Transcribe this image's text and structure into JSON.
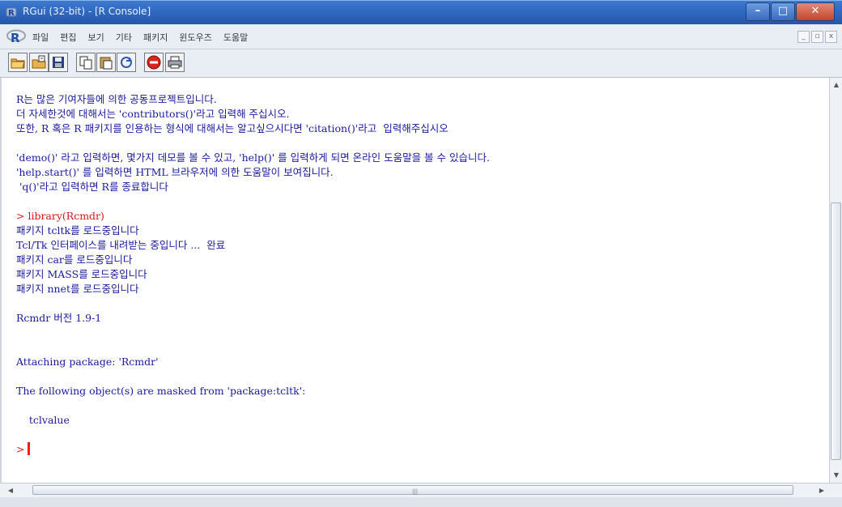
{
  "window": {
    "title": "RGui (32-bit) - [R Console]",
    "accent": "#2f66bd",
    "controls": {
      "minimize": "–",
      "maximize": "□",
      "close": "✕"
    }
  },
  "menubar": {
    "logo": "R",
    "items": [
      "파일",
      "편집",
      "보기",
      "기타",
      "패키지",
      "윈도우즈",
      "도움말"
    ],
    "mdi_controls": [
      "_",
      "▫",
      "x"
    ]
  },
  "toolbar": {
    "buttons": [
      "open-script-icon",
      "load-workspace-icon",
      "save-icon",
      "copy-icon",
      "paste-icon",
      "copy-paste-icon",
      "stop-icon",
      "print-icon"
    ]
  },
  "console": {
    "lines": [
      {
        "text": "R는 많은 기여자들에 의한 공동프로젝트입니다.",
        "type": "out"
      },
      {
        "text": "더 자세한것에 대해서는 'contributors()'라고 입력해 주십시오.",
        "type": "out"
      },
      {
        "text": "또한, R 혹은 R 패키지를 인용하는 형식에 대해서는 알고싶으시다면 'citation()'라고  입력해주십시오",
        "type": "out"
      },
      {
        "text": "",
        "type": "gap"
      },
      {
        "text": "'demo()' 라고 입력하면, 몇가지 데모를 볼 수 있고, 'help()' 를 입력하게 되면 온라인 도움말을 볼 수 있습니다.",
        "type": "out"
      },
      {
        "text": "'help.start()' 를 입력하면 HTML 브라우저에 의한 도움말이 보여집니다.",
        "type": "out"
      },
      {
        "text": " 'q()'라고 입력하면 R를 종료합니다",
        "type": "out"
      },
      {
        "text": "",
        "type": "gap"
      },
      {
        "text": "> library(Rcmdr)",
        "type": "cmd"
      },
      {
        "text": "패키지 tcltk를 로드중입니다",
        "type": "out"
      },
      {
        "text": "Tcl/Tk 인터페이스를 내려받는 중입니다 ...  완료",
        "type": "out"
      },
      {
        "text": "패키지 car를 로드중입니다",
        "type": "out"
      },
      {
        "text": "패키지 MASS를 로드중입니다",
        "type": "out"
      },
      {
        "text": "패키지 nnet를 로드중입니다",
        "type": "out"
      },
      {
        "text": "",
        "type": "gap"
      },
      {
        "text": "Rcmdr 버전 1.9-1",
        "type": "out"
      },
      {
        "text": "",
        "type": "gap"
      },
      {
        "text": "",
        "type": "gap"
      },
      {
        "text": "Attaching package: 'Rcmdr'",
        "type": "out"
      },
      {
        "text": "",
        "type": "gap"
      },
      {
        "text": "The following object(s) are masked from 'package:tcltk':",
        "type": "out"
      },
      {
        "text": "",
        "type": "gap"
      },
      {
        "text": "    tclvalue",
        "type": "out"
      },
      {
        "text": "",
        "type": "gap"
      }
    ],
    "prompt": ">",
    "output_color": "#1a1aa0",
    "command_color": "#d21919"
  }
}
